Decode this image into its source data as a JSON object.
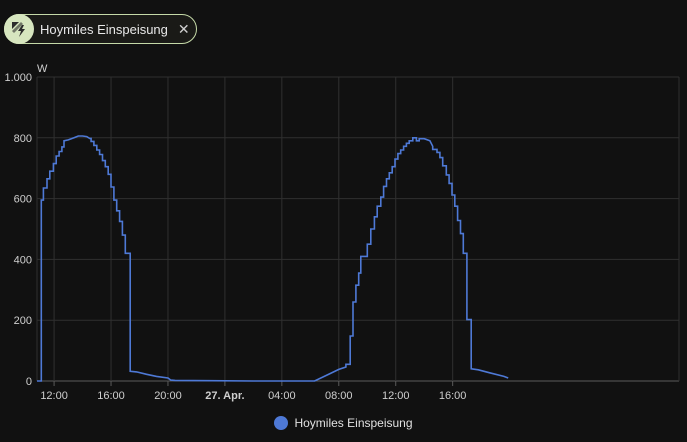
{
  "filter_chip": {
    "label": "Hoymiles Einspeisung",
    "icon": "solar-power-icon",
    "close_icon": "close-icon"
  },
  "chart_data": {
    "type": "line",
    "ylabel": "W",
    "ylim": [
      0,
      1000
    ],
    "y_ticks": [
      0,
      200,
      400,
      600,
      800,
      1000
    ],
    "y_tick_labels": [
      "0",
      "200",
      "400",
      "600",
      "800",
      "1.000"
    ],
    "x_range_hours": [
      10.8,
      55.9
    ],
    "x_ticks": [
      {
        "h": 12,
        "label": "12:00",
        "bold": false
      },
      {
        "h": 16,
        "label": "16:00",
        "bold": false
      },
      {
        "h": 20,
        "label": "20:00",
        "bold": false
      },
      {
        "h": 24,
        "label": "27. Apr.",
        "bold": true
      },
      {
        "h": 28,
        "label": "04:00",
        "bold": false
      },
      {
        "h": 32,
        "label": "08:00",
        "bold": false
      },
      {
        "h": 36,
        "label": "12:00",
        "bold": false
      },
      {
        "h": 40,
        "label": "16:00",
        "bold": false
      }
    ],
    "grid": true,
    "legend_position": "bottom",
    "series": [
      {
        "name": "Hoymiles Einspeisung",
        "color": "#4e79d6",
        "points": [
          [
            10.8,
            0
          ],
          [
            11.1,
            0
          ],
          [
            11.1,
            595
          ],
          [
            11.25,
            595
          ],
          [
            11.25,
            635
          ],
          [
            11.5,
            635
          ],
          [
            11.5,
            665
          ],
          [
            11.7,
            665
          ],
          [
            11.7,
            690
          ],
          [
            11.95,
            690
          ],
          [
            11.95,
            715
          ],
          [
            12.15,
            715
          ],
          [
            12.15,
            740
          ],
          [
            12.35,
            740
          ],
          [
            12.35,
            755
          ],
          [
            12.55,
            755
          ],
          [
            12.55,
            770
          ],
          [
            12.7,
            770
          ],
          [
            12.7,
            790
          ],
          [
            13.0,
            793
          ],
          [
            13.4,
            800
          ],
          [
            13.7,
            806
          ],
          [
            14.0,
            806
          ],
          [
            14.3,
            804
          ],
          [
            14.5,
            798
          ],
          [
            14.6,
            798
          ],
          [
            14.6,
            788
          ],
          [
            14.8,
            788
          ],
          [
            14.8,
            775
          ],
          [
            15.0,
            775
          ],
          [
            15.0,
            760
          ],
          [
            15.2,
            760
          ],
          [
            15.2,
            745
          ],
          [
            15.4,
            745
          ],
          [
            15.4,
            725
          ],
          [
            15.6,
            725
          ],
          [
            15.6,
            705
          ],
          [
            15.8,
            705
          ],
          [
            15.8,
            680
          ],
          [
            16.0,
            680
          ],
          [
            16.0,
            638
          ],
          [
            16.2,
            638
          ],
          [
            16.2,
            595
          ],
          [
            16.4,
            595
          ],
          [
            16.4,
            560
          ],
          [
            16.6,
            560
          ],
          [
            16.6,
            525
          ],
          [
            16.8,
            525
          ],
          [
            16.8,
            480
          ],
          [
            17.0,
            480
          ],
          [
            17.0,
            420
          ],
          [
            17.35,
            420
          ],
          [
            17.35,
            32
          ],
          [
            17.8,
            30
          ],
          [
            18.5,
            22
          ],
          [
            19.2,
            15
          ],
          [
            20.0,
            10
          ],
          [
            20.2,
            3
          ],
          [
            20.5,
            2
          ],
          [
            23.0,
            1
          ],
          [
            26.0,
            0
          ],
          [
            30.0,
            0
          ],
          [
            30.3,
            0
          ],
          [
            31.2,
            20
          ],
          [
            32.0,
            38
          ],
          [
            32.5,
            46
          ],
          [
            32.5,
            55
          ],
          [
            32.8,
            55
          ],
          [
            32.8,
            148
          ],
          [
            33.0,
            148
          ],
          [
            33.0,
            260
          ],
          [
            33.2,
            260
          ],
          [
            33.2,
            315
          ],
          [
            33.4,
            315
          ],
          [
            33.4,
            355
          ],
          [
            33.55,
            355
          ],
          [
            33.55,
            410
          ],
          [
            34.0,
            410
          ],
          [
            34.0,
            450
          ],
          [
            34.25,
            450
          ],
          [
            34.25,
            500
          ],
          [
            34.5,
            500
          ],
          [
            34.5,
            540
          ],
          [
            34.7,
            540
          ],
          [
            34.7,
            575
          ],
          [
            34.95,
            575
          ],
          [
            34.95,
            605
          ],
          [
            35.15,
            605
          ],
          [
            35.15,
            640
          ],
          [
            35.35,
            640
          ],
          [
            35.35,
            665
          ],
          [
            35.55,
            665
          ],
          [
            35.55,
            685
          ],
          [
            35.75,
            685
          ],
          [
            35.75,
            705
          ],
          [
            35.95,
            705
          ],
          [
            35.95,
            730
          ],
          [
            36.15,
            730
          ],
          [
            36.15,
            748
          ],
          [
            36.35,
            748
          ],
          [
            36.35,
            760
          ],
          [
            36.55,
            760
          ],
          [
            36.55,
            772
          ],
          [
            36.75,
            772
          ],
          [
            36.75,
            782
          ],
          [
            36.95,
            782
          ],
          [
            36.95,
            790
          ],
          [
            37.2,
            790
          ],
          [
            37.2,
            800
          ],
          [
            37.45,
            800
          ],
          [
            37.45,
            790
          ],
          [
            37.65,
            790
          ],
          [
            37.65,
            797
          ],
          [
            38.0,
            797
          ],
          [
            38.4,
            790
          ],
          [
            38.6,
            772
          ],
          [
            38.6,
            762
          ],
          [
            38.9,
            762
          ],
          [
            38.9,
            752
          ],
          [
            39.1,
            752
          ],
          [
            39.1,
            735
          ],
          [
            39.3,
            735
          ],
          [
            39.3,
            708
          ],
          [
            39.55,
            708
          ],
          [
            39.55,
            678
          ],
          [
            39.75,
            678
          ],
          [
            39.75,
            650
          ],
          [
            39.95,
            650
          ],
          [
            39.95,
            612
          ],
          [
            40.15,
            612
          ],
          [
            40.15,
            575
          ],
          [
            40.35,
            575
          ],
          [
            40.35,
            528
          ],
          [
            40.55,
            528
          ],
          [
            40.55,
            485
          ],
          [
            40.75,
            485
          ],
          [
            40.75,
            420
          ],
          [
            41.0,
            420
          ],
          [
            41.0,
            202
          ],
          [
            41.3,
            202
          ],
          [
            41.3,
            40
          ],
          [
            41.8,
            37
          ],
          [
            42.6,
            27
          ],
          [
            43.6,
            15
          ],
          [
            43.9,
            10
          ]
        ]
      }
    ]
  }
}
